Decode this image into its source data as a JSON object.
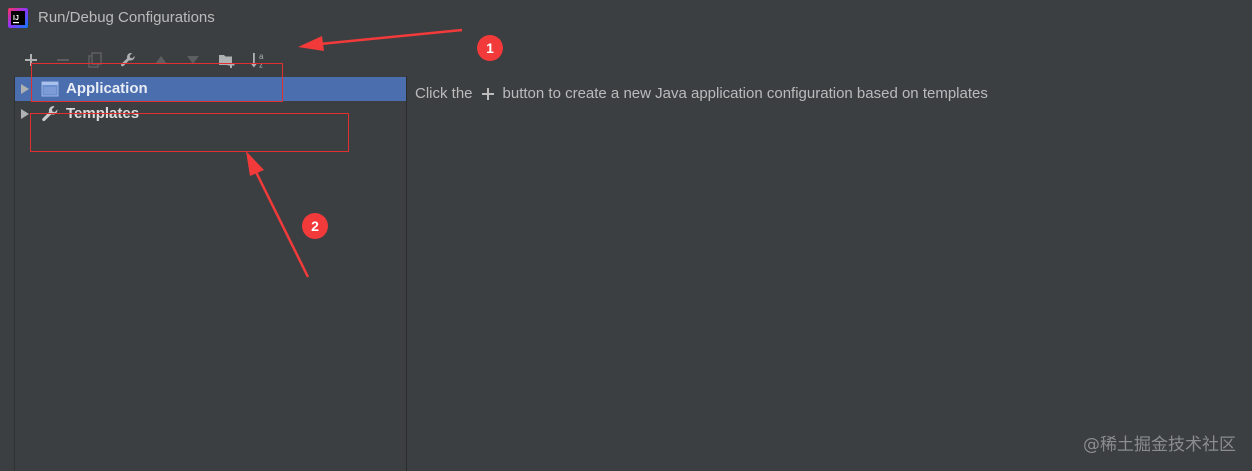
{
  "window": {
    "title": "Run/Debug Configurations"
  },
  "toolbar": {
    "buttons": [
      {
        "name": "add",
        "icon": "plus-icon",
        "enabled": true
      },
      {
        "name": "remove",
        "icon": "minus-icon",
        "enabled": false
      },
      {
        "name": "copy",
        "icon": "copy-icon",
        "enabled": false
      },
      {
        "name": "edit-templates",
        "icon": "wrench-icon",
        "enabled": true
      },
      {
        "name": "move-up",
        "icon": "arrow-up-icon",
        "enabled": false
      },
      {
        "name": "move-down",
        "icon": "arrow-down-icon",
        "enabled": false
      },
      {
        "name": "new-folder",
        "icon": "folder-add-icon",
        "enabled": true
      },
      {
        "name": "sort",
        "icon": "sort-alpha-icon",
        "enabled": true
      }
    ]
  },
  "tree": {
    "items": [
      {
        "label": "Application",
        "icon": "application-window-icon",
        "selected": true
      },
      {
        "label": "Templates",
        "icon": "wrench-icon",
        "selected": false
      }
    ]
  },
  "main": {
    "hint_prefix": "Click the",
    "hint_suffix": "button to create a new Java application configuration based on templates"
  },
  "annotations": {
    "badge_1": "1",
    "badge_2": "2",
    "color": "#f23a3a"
  },
  "watermark": "@稀土掘金技术社区",
  "colors": {
    "background": "#3c3f41",
    "selection": "#4b6eaf",
    "text": "#bbbbbb"
  }
}
